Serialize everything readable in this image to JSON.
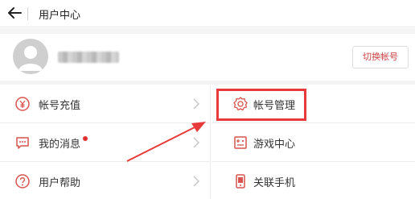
{
  "header": {
    "title": "用户中心",
    "back_icon": "arrow-left-icon"
  },
  "profile": {
    "avatar_icon": "user-avatar-icon",
    "switch_label": "切换帐号"
  },
  "menu": {
    "left": [
      {
        "label": "帐号充值",
        "icon": "yen-coin-icon"
      },
      {
        "label": "我的消息",
        "icon": "chat-bubble-icon",
        "has_unread_dot": true
      },
      {
        "label": "用户帮助",
        "icon": "help-circle-icon"
      }
    ],
    "right": [
      {
        "label": "帐号管理",
        "icon": "gear-icon"
      },
      {
        "label": "游戏中心",
        "icon": "gamepad-icon"
      },
      {
        "label": "关联手机",
        "icon": "phone-icon"
      }
    ]
  },
  "colors": {
    "accent": "#e83a3a",
    "icon_red": "#d9534f",
    "divider": "#ededed"
  }
}
